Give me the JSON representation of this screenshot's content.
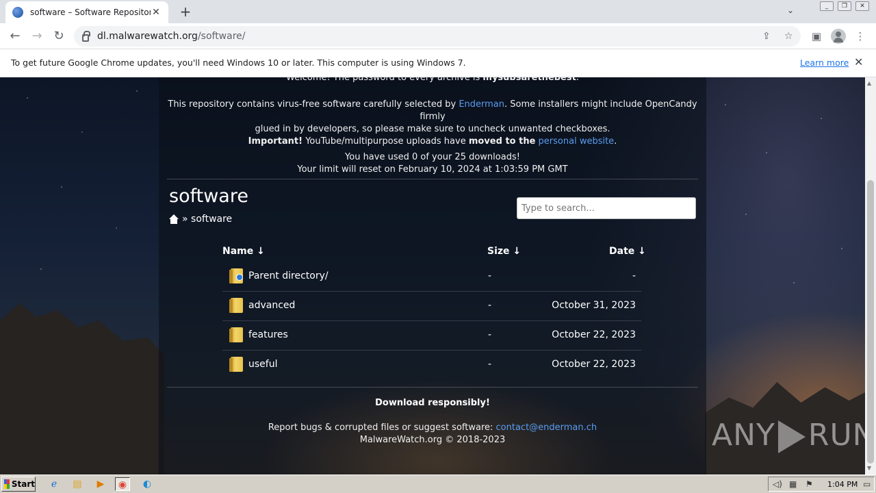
{
  "browser": {
    "tab_title": "software – Software Repository",
    "url_host": "dl.malwarewatch.org",
    "url_path": "/software/",
    "infobar_text": "To get future Google Chrome updates, you'll need Windows 10 or later. This computer is using Windows 7.",
    "infobar_link": "Learn more"
  },
  "intro": {
    "clipped_prefix": "Welcome! The password to every archive is ",
    "clipped_password": "mysubsarethebest",
    "clipped_suffix": ".",
    "p1_a": "This repository contains virus-free software carefully selected by ",
    "p1_link": "Enderman",
    "p1_b": ". Some installers might include OpenCandy firmly",
    "p1_line2": "glued in by developers, so please make sure to uncheck unwanted checkboxes.",
    "p2_bold1": "Important!",
    "p2_a": " YouTube/multipurpose uploads have ",
    "p2_bold2": "moved to the",
    "p2_space": " ",
    "p2_link": "personal website",
    "p2_end": ".",
    "quota": "You have used 0 of your 25 downloads!",
    "reset": "Your limit will reset on February 10, 2024 at 1:03:59 PM GMT"
  },
  "listing": {
    "title": "software",
    "breadcrumb_sep": "»",
    "breadcrumb_current": "software",
    "search_placeholder": "Type to search...",
    "columns": {
      "name": "Name ↓",
      "size": "Size ↓",
      "date": "Date ↓"
    },
    "rows": [
      {
        "name": "Parent directory/",
        "size": "-",
        "date": "-"
      },
      {
        "name": "advanced",
        "size": "-",
        "date": "October 31, 2023"
      },
      {
        "name": "features",
        "size": "-",
        "date": "October 22, 2023"
      },
      {
        "name": "useful",
        "size": "-",
        "date": "October 22, 2023"
      }
    ]
  },
  "footer": {
    "title": "Download responsibly!",
    "report_text": "Report bugs & corrupted files or suggest software: ",
    "report_link": "contact@enderman.ch",
    "copyright": "MalwareWatch.org © 2018-2023"
  },
  "watermark": {
    "left": "ANY",
    "right": "RUN"
  },
  "taskbar": {
    "start_label": "Start",
    "clock": "1:04 PM"
  }
}
